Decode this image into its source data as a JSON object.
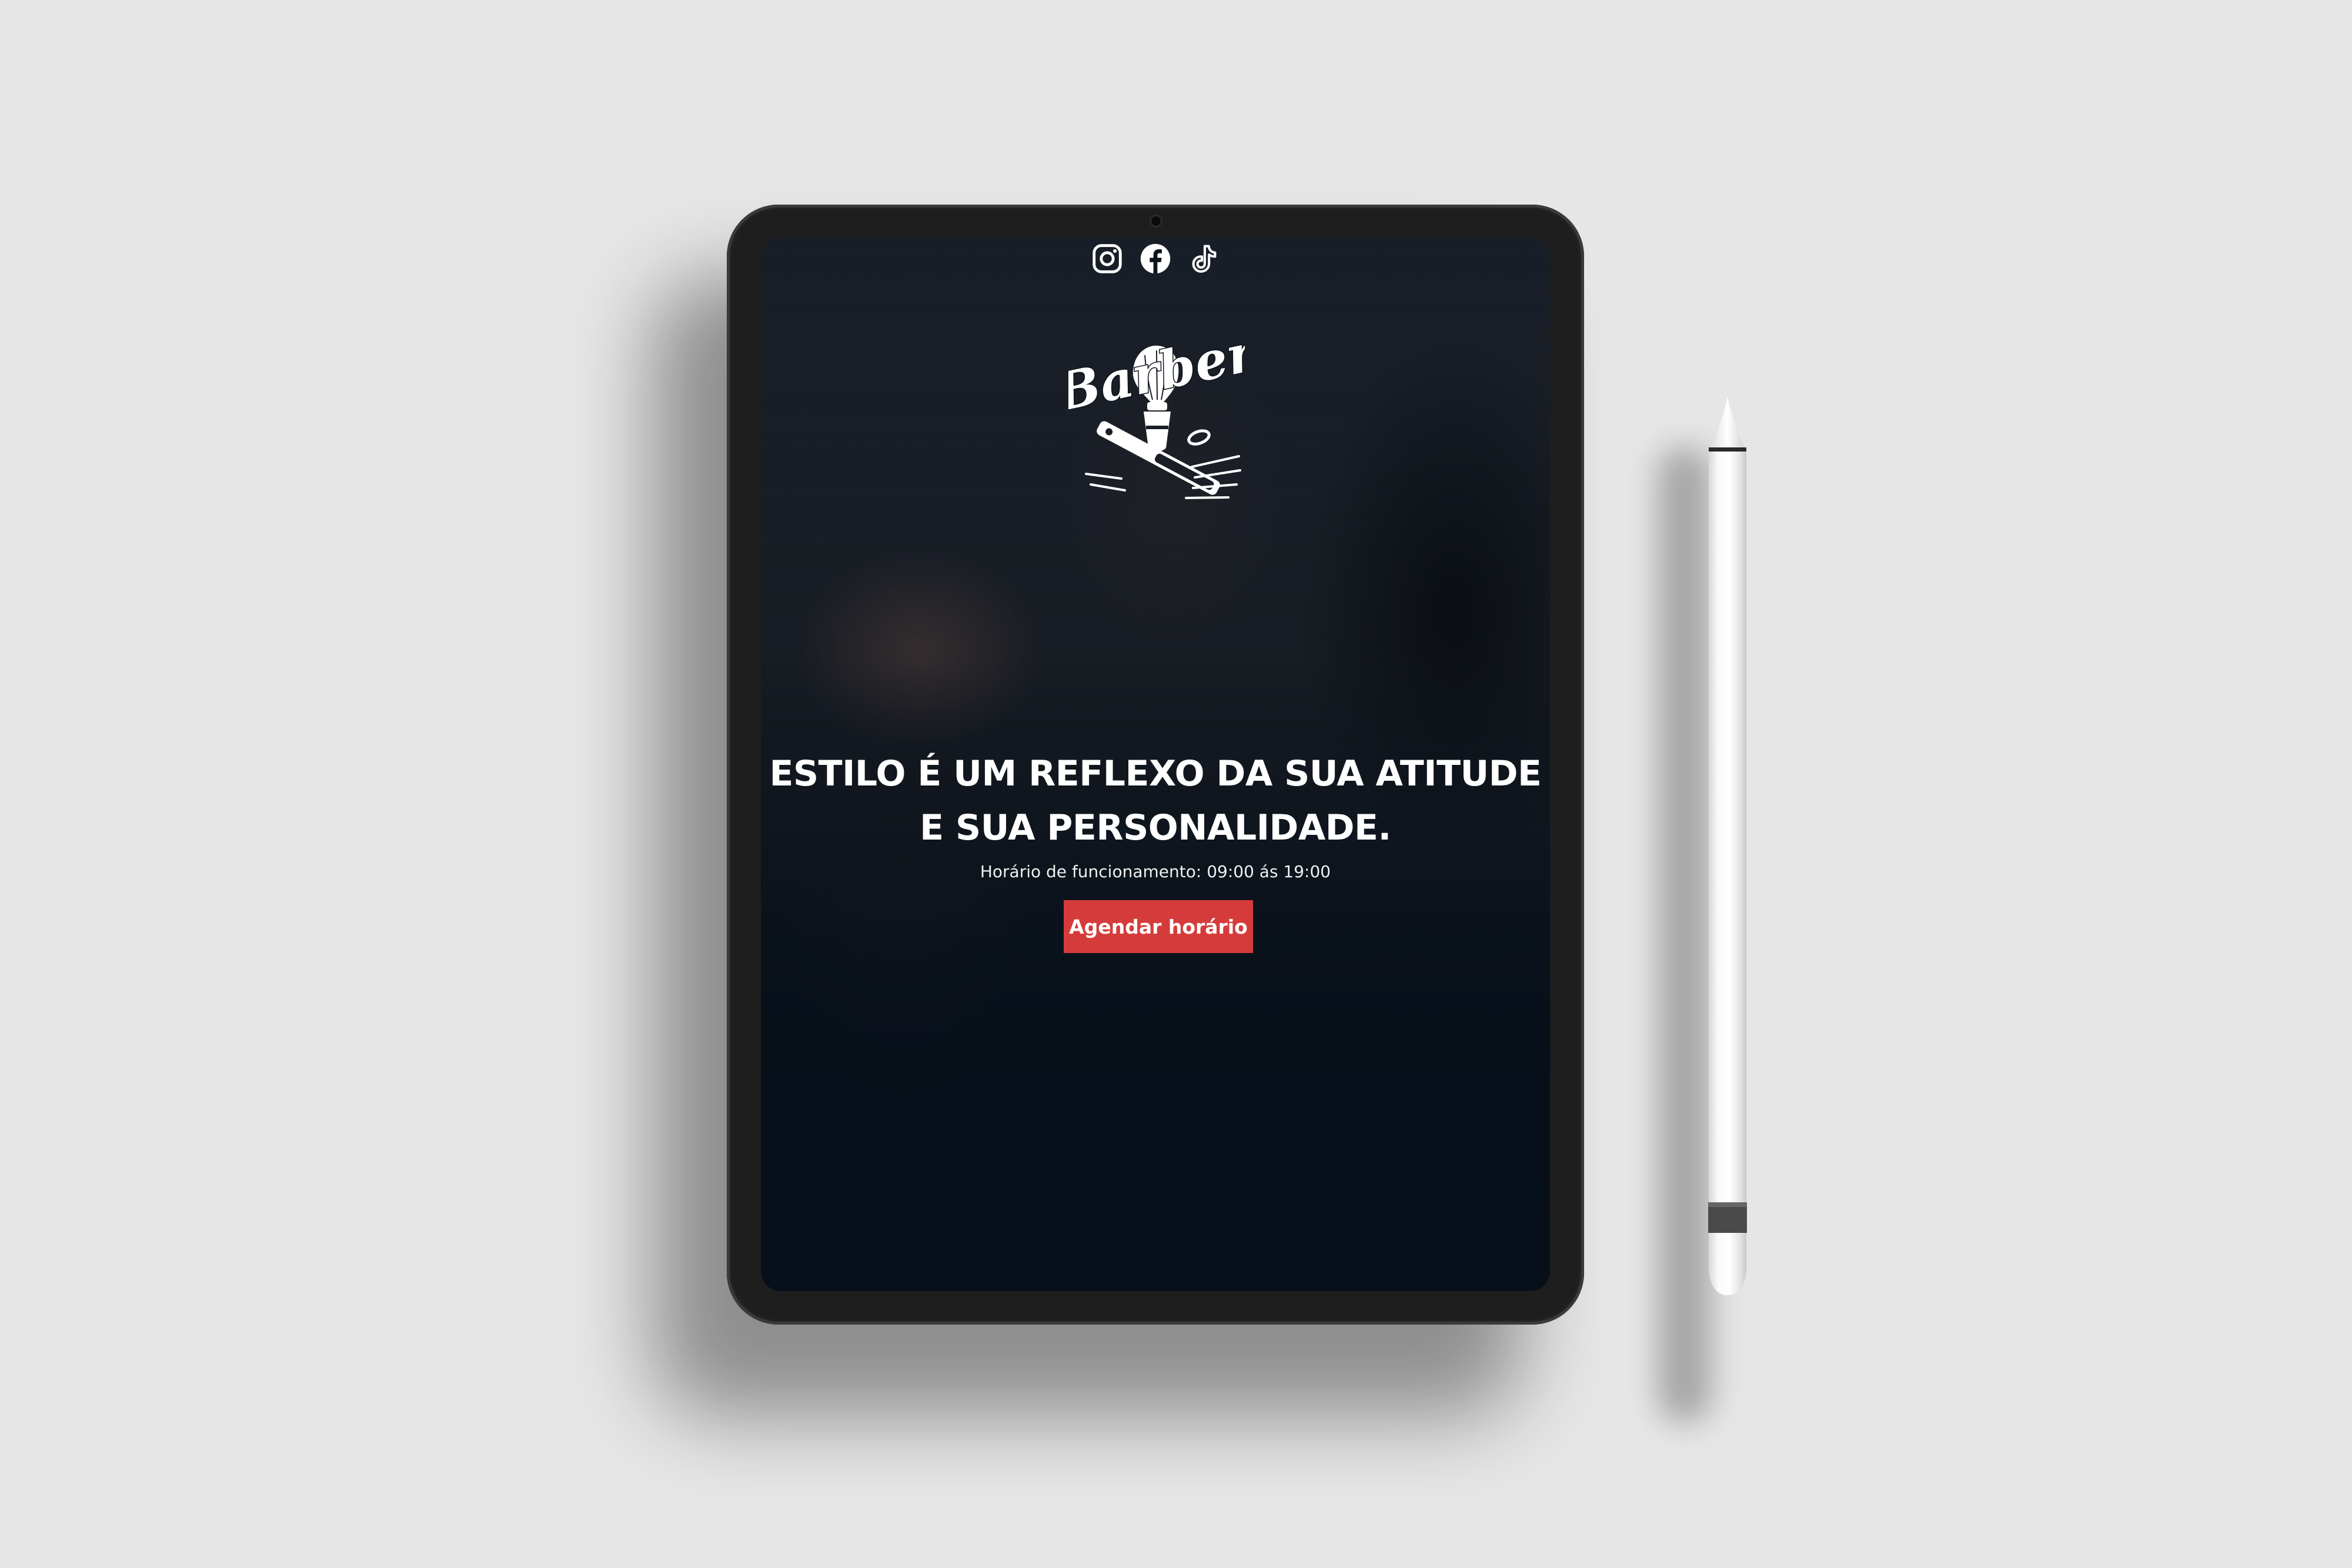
{
  "socials": [
    {
      "name": "instagram",
      "icon": "instagram-icon"
    },
    {
      "name": "facebook",
      "icon": "facebook-icon"
    },
    {
      "name": "tiktok",
      "icon": "tiktok-icon"
    }
  ],
  "logo": {
    "text": "Barber",
    "icon": "barber-logo-brush-razor"
  },
  "hero": {
    "headline_line1": "ESTILO É UM REFLEXO DA SUA ATITUDE",
    "headline_line2": "E SUA PERSONALIDADE.",
    "hours": "Horário de funcionamento: 09:00 ás 19:00",
    "cta_label": "Agendar horário"
  },
  "colors": {
    "page_background": "#e6e6e6",
    "tablet_frame": "#1e1e1f",
    "screen_overlay": "#07101b",
    "cta": "#d63b3b",
    "text": "#ffffff"
  }
}
